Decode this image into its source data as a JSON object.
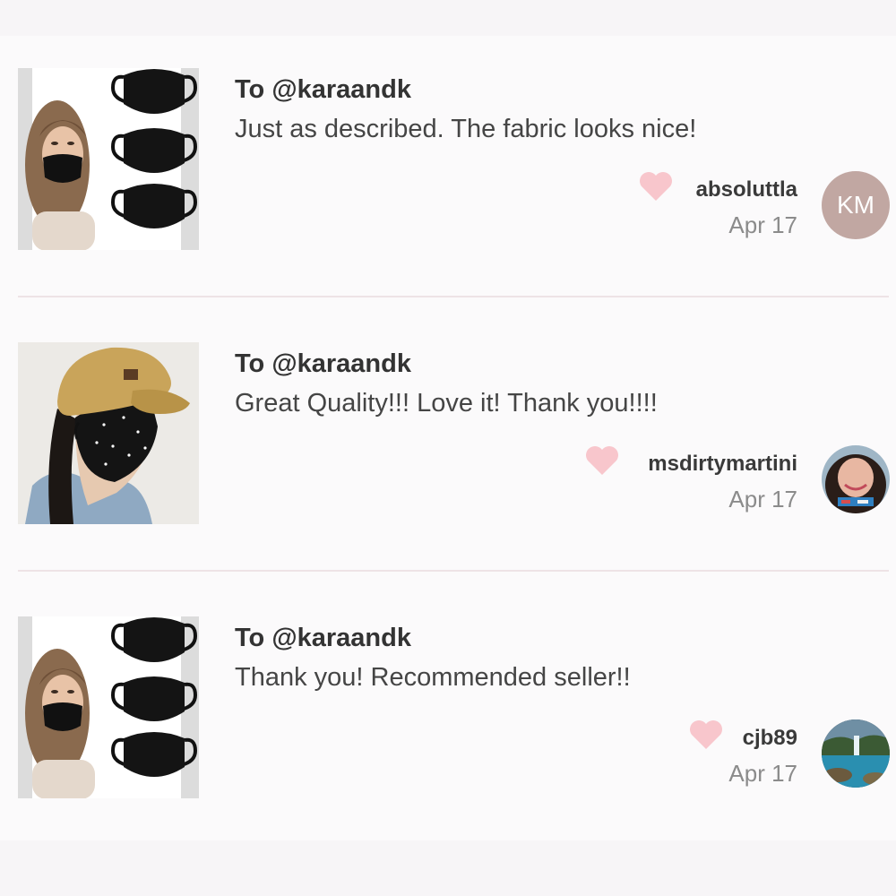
{
  "reviews": [
    {
      "recipient": "To @karaandk",
      "message": "Just as described. The fabric looks nice!",
      "username": "absoluttla",
      "date": "Apr 17",
      "avatar_initials": "KM",
      "product": "black-face-masks-3-pack"
    },
    {
      "recipient": "To @karaandk",
      "message": "Great Quality!!! Love it! Thank you!!!!",
      "username": "msdirtymartini",
      "date": "Apr 17",
      "product": "star-print-face-mask"
    },
    {
      "recipient": "To @karaandk",
      "message": "Thank you! Recommended seller!!",
      "username": "cjb89",
      "date": "Apr 17",
      "product": "black-face-masks-3-pack"
    }
  ],
  "colors": {
    "heart": "#f8c6cc",
    "divider": "#eee3e6",
    "avatar_initials_bg": "#c1a7a2"
  },
  "icons": {
    "like": "heart-icon"
  }
}
